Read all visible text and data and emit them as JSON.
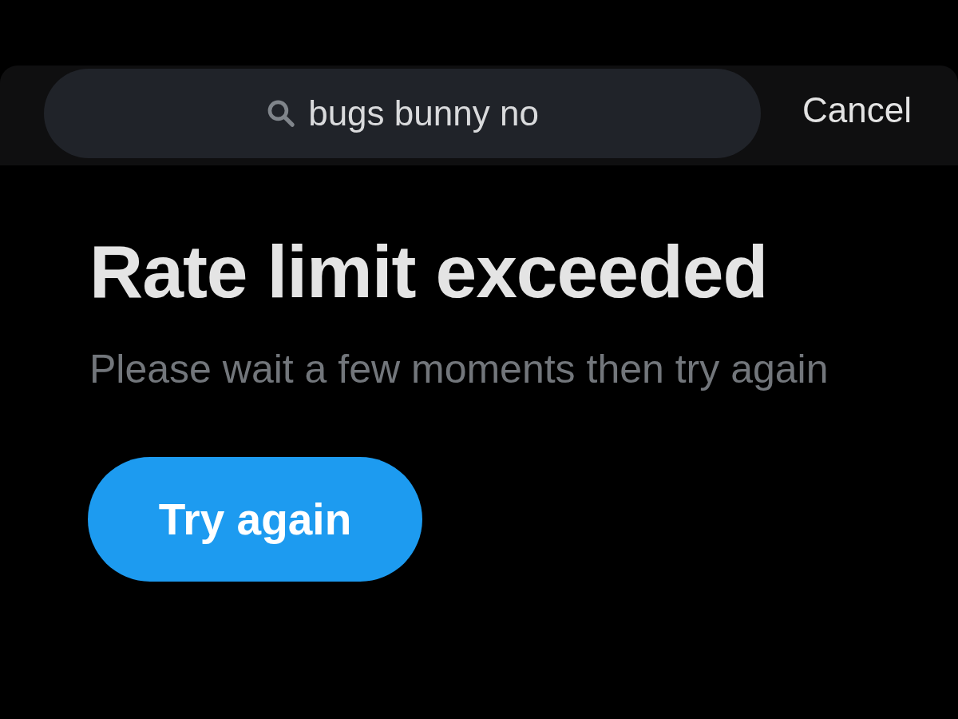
{
  "search": {
    "value": "bugs bunny no"
  },
  "cancel": "Cancel",
  "error": {
    "title": "Rate limit exceeded",
    "message": "Please wait a few moments then try again",
    "button": "Try again"
  }
}
